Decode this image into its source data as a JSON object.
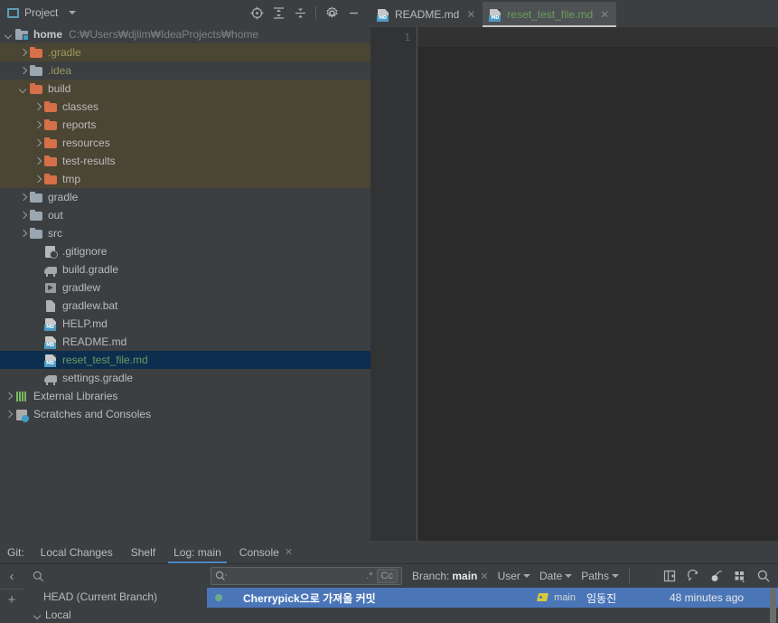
{
  "project_panel": {
    "title": "Project",
    "title_icon": "project-window-icon",
    "dropdown_icon": "chevron-down-icon",
    "toolbar": [
      {
        "name": "select-opened-file-icon",
        "tooltip": "Select Opened File"
      },
      {
        "name": "expand-all-icon",
        "tooltip": "Expand All"
      },
      {
        "name": "collapse-all-icon",
        "tooltip": "Collapse All"
      },
      {
        "name": "gear-icon",
        "tooltip": "Settings"
      },
      {
        "name": "minimize-icon",
        "tooltip": "Hide"
      }
    ]
  },
  "tree": [
    {
      "label": "home",
      "path": "C:₩Users₩djlim₩IdeaProjects₩home",
      "icon": "module-icon",
      "arrow": "down",
      "indent": 0,
      "style": "bold",
      "state": "normal"
    },
    {
      "label": ".gradle",
      "icon": "folder-orange-icon",
      "arrow": "right",
      "indent": 1,
      "style": "olive",
      "state": "highlight"
    },
    {
      "label": ".idea",
      "icon": "folder-gray-icon",
      "arrow": "right",
      "indent": 1,
      "style": "olive",
      "state": "normal"
    },
    {
      "label": "build",
      "icon": "folder-orange-icon",
      "arrow": "down",
      "indent": 1,
      "style": "plain",
      "state": "highlight"
    },
    {
      "label": "classes",
      "icon": "folder-orange-icon",
      "arrow": "right",
      "indent": 2,
      "style": "plain",
      "state": "highlight"
    },
    {
      "label": "reports",
      "icon": "folder-orange-icon",
      "arrow": "right",
      "indent": 2,
      "style": "plain",
      "state": "highlight"
    },
    {
      "label": "resources",
      "icon": "folder-orange-icon",
      "arrow": "right",
      "indent": 2,
      "style": "plain",
      "state": "highlight"
    },
    {
      "label": "test-results",
      "icon": "folder-orange-icon",
      "arrow": "right",
      "indent": 2,
      "style": "plain",
      "state": "highlight"
    },
    {
      "label": "tmp",
      "icon": "folder-orange-icon",
      "arrow": "right",
      "indent": 2,
      "style": "plain",
      "state": "highlight"
    },
    {
      "label": "gradle",
      "icon": "folder-gray-icon",
      "arrow": "right",
      "indent": 1,
      "style": "plain",
      "state": "normal"
    },
    {
      "label": "out",
      "icon": "folder-gray-icon",
      "arrow": "right",
      "indent": 1,
      "style": "plain",
      "state": "normal"
    },
    {
      "label": "src",
      "icon": "folder-gray-icon",
      "arrow": "right",
      "indent": 1,
      "style": "plain",
      "state": "normal"
    },
    {
      "label": ".gitignore",
      "icon": "gitignore-file-icon",
      "arrow": "none",
      "indent": 2,
      "style": "plain",
      "state": "normal"
    },
    {
      "label": "build.gradle",
      "icon": "gradle-file-icon",
      "arrow": "none",
      "indent": 2,
      "style": "plain",
      "state": "normal"
    },
    {
      "label": "gradlew",
      "icon": "shell-script-icon",
      "arrow": "none",
      "indent": 2,
      "style": "plain",
      "state": "normal"
    },
    {
      "label": "gradlew.bat",
      "icon": "bat-file-icon",
      "arrow": "none",
      "indent": 2,
      "style": "plain",
      "state": "normal"
    },
    {
      "label": "HELP.md",
      "icon": "markdown-file-icon",
      "arrow": "none",
      "indent": 2,
      "style": "plain",
      "state": "normal"
    },
    {
      "label": "README.md",
      "icon": "markdown-file-icon",
      "arrow": "none",
      "indent": 2,
      "style": "plain",
      "state": "normal"
    },
    {
      "label": "reset_test_file.md",
      "icon": "markdown-file-icon",
      "arrow": "none",
      "indent": 2,
      "style": "green",
      "state": "selected"
    },
    {
      "label": "settings.gradle",
      "icon": "gradle-file-icon",
      "arrow": "none",
      "indent": 2,
      "style": "plain",
      "state": "normal"
    },
    {
      "label": "External Libraries",
      "icon": "external-libraries-icon",
      "arrow": "right",
      "indent": 0,
      "style": "plain",
      "state": "normal"
    },
    {
      "label": "Scratches and Consoles",
      "icon": "scratches-icon",
      "arrow": "right",
      "indent": 0,
      "style": "plain",
      "state": "normal"
    }
  ],
  "editor_tabs": [
    {
      "label": "README.md",
      "icon": "markdown-file-icon",
      "active": false,
      "close_icon": "close-icon"
    },
    {
      "label": "reset_test_file.md",
      "icon": "markdown-file-icon",
      "active": true,
      "close_icon": "close-icon"
    }
  ],
  "editor": {
    "line_numbers": [
      "1"
    ],
    "content": ""
  },
  "git_panel": {
    "label": "Git:",
    "tabs": [
      {
        "label": "Local Changes",
        "active": false,
        "closable": false
      },
      {
        "label": "Shelf",
        "active": false,
        "closable": false
      },
      {
        "label": "Log: main",
        "active": true,
        "closable": false
      },
      {
        "label": "Console",
        "active": false,
        "closable": true,
        "close_icon": "close-icon"
      }
    ],
    "side_buttons": [
      {
        "name": "collapse-panel-button",
        "glyph": "‹"
      },
      {
        "name": "add-button",
        "glyph": "+"
      }
    ],
    "branch_pane": {
      "search_placeholder": "",
      "search_icon": "search-icon",
      "rows": [
        {
          "label": "HEAD (Current Branch)",
          "arrow": "none",
          "indent": 1
        },
        {
          "label": "Local",
          "arrow": "down",
          "indent": 0
        }
      ]
    },
    "log_toolbar": {
      "search_icon": "search-dropdown-icon",
      "search_value": "",
      "regex_toggle": ".*",
      "case_toggle": "Cc",
      "filters": [
        {
          "name": "branch-filter",
          "label": "Branch:",
          "value": "main",
          "close_icon": "close-icon"
        },
        {
          "name": "user-filter",
          "label": "User",
          "value": "",
          "caret_icon": "chevron-down-icon"
        },
        {
          "name": "date-filter",
          "label": "Date",
          "value": "",
          "caret_icon": "chevron-down-icon"
        },
        {
          "name": "paths-filter",
          "label": "Paths",
          "value": "",
          "caret_icon": "chevron-down-icon"
        }
      ],
      "icons": [
        {
          "name": "show-details-icon"
        },
        {
          "name": "refresh-icon"
        },
        {
          "name": "cherry-pick-icon"
        },
        {
          "name": "show-as-table-icon"
        },
        {
          "name": "search-icon"
        }
      ]
    },
    "commits": [
      {
        "message": "Cherrypick으로 가져올 커밋",
        "tag_icon": "branch-tag-icon",
        "branch": "main",
        "author": "임동진",
        "date": "48 minutes ago",
        "selected": true
      }
    ]
  },
  "colors": {
    "window_bg": "#3c3f41",
    "editor_bg": "#2b2b2b",
    "gutter_bg": "#313335",
    "selection_blue": "#0d2e4e",
    "highlight_olive": "#4b4534",
    "accent_blue": "#4a88c7",
    "commit_selected": "#4a76b8",
    "folder_orange": "#d5704a",
    "folder_gray": "#9aa7b0",
    "md_blue": "#4b9cc4",
    "green_text": "#6a9e5e",
    "olive_text": "#9a9a5c"
  }
}
